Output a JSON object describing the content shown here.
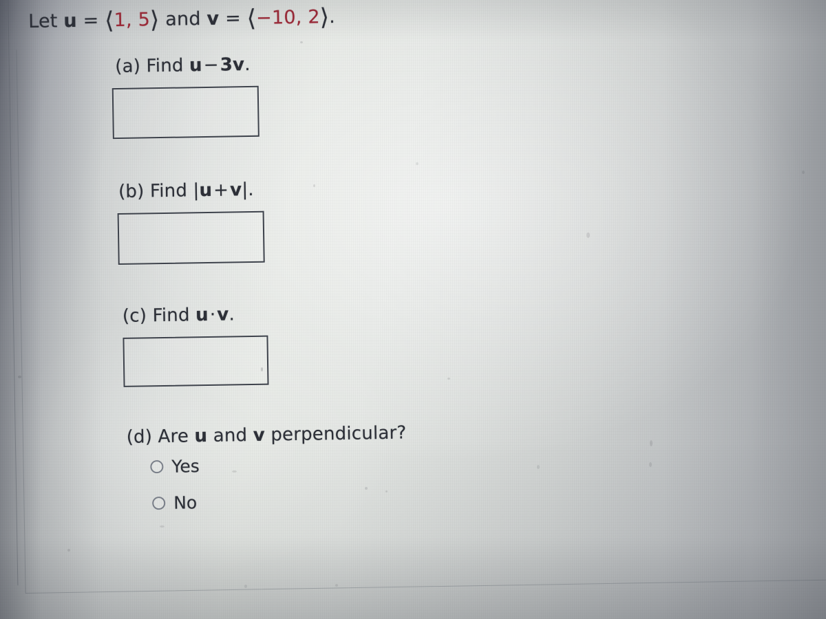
{
  "problem": {
    "intro": {
      "let": "Let",
      "u_symbol": "u",
      "equals": "=",
      "u_open": "⟨",
      "u_x": "1",
      "u_comma": ", ",
      "u_y": "5",
      "u_close": "⟩",
      "and": "and",
      "v_symbol": "v",
      "v_open": "⟨",
      "v_x": "−10",
      "v_comma": ", ",
      "v_y": "2",
      "v_close": "⟩",
      "period": "."
    },
    "parts": [
      {
        "id": "a",
        "label": "(a)",
        "verb": "Find",
        "expr_prefix": "",
        "expr_a": "u",
        "expr_op": "−",
        "expr_b": "3v",
        "expr_suffix": "",
        "period": ".",
        "answer_value": "",
        "answer_placeholder": ""
      },
      {
        "id": "b",
        "label": "(b)",
        "verb": "Find",
        "expr_prefix": "|",
        "expr_a": "u",
        "expr_op": "+",
        "expr_b": "v",
        "expr_suffix": "|",
        "period": ".",
        "answer_value": "",
        "answer_placeholder": ""
      },
      {
        "id": "c",
        "label": "(c)",
        "verb": "Find",
        "expr_prefix": "",
        "expr_a": "u",
        "expr_op": "·",
        "expr_b": "v",
        "expr_suffix": "",
        "period": ".",
        "answer_value": "",
        "answer_placeholder": ""
      }
    ],
    "part_d": {
      "id": "d",
      "label": "(d)",
      "question_prefix": "Are",
      "u_symbol": "u",
      "question_mid": "and",
      "v_symbol": "v",
      "question_suffix": "perpendicular?",
      "options": [
        {
          "value": "yes",
          "label": "Yes",
          "selected": false
        },
        {
          "value": "no",
          "label": "No",
          "selected": false
        }
      ]
    }
  },
  "colors": {
    "text": "#2d3038",
    "vector_number": "#a02a38",
    "box_border": "#3e434c",
    "radio_border": "#7c828c",
    "page_light": "#e4e7e3",
    "page_dark": "#7f838d"
  }
}
